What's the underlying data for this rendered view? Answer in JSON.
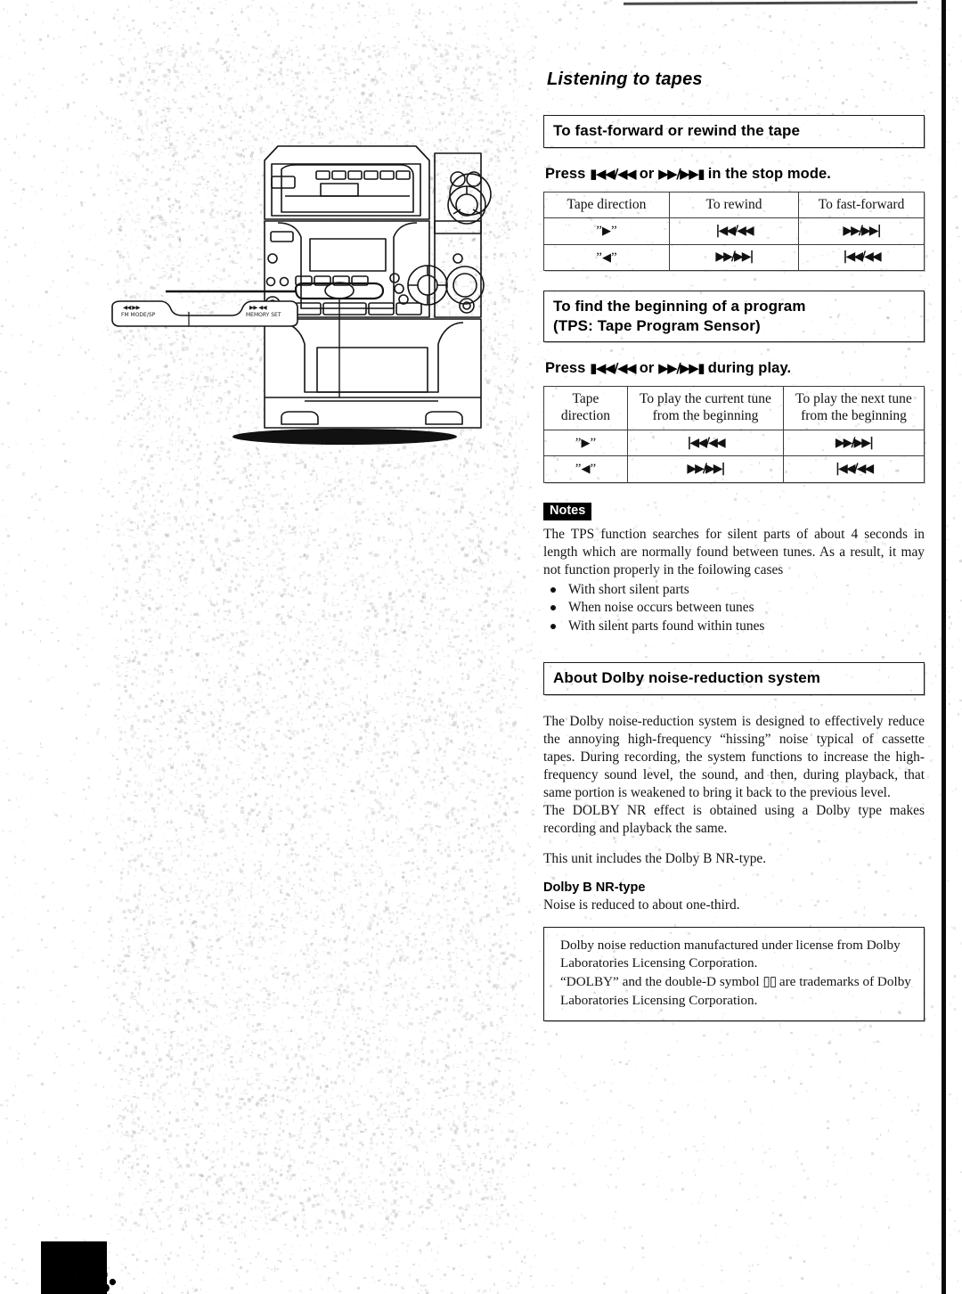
{
  "page": {
    "title": "Listening to tapes"
  },
  "sections": {
    "fast_forward": {
      "heading": "To fast-forward or rewind the tape",
      "press_prefix": "Press",
      "press_glyph_a": "⏪",
      "press_mid": "or",
      "press_glyph_b": "⏩",
      "press_suffix": "in the stop mode.",
      "press_full": "Press |◀◀/◀◀ or ▶▶/▶▶| in the stop mode.",
      "table": {
        "headers": [
          "Tape direction",
          "To rewind",
          "To fast-forward"
        ],
        "rows": [
          {
            "direction": "“▶”",
            "rewind": "|◀◀/◀◀",
            "fast_forward": "▶▶/▶▶|"
          },
          {
            "direction": "“◀”",
            "rewind": "▶▶/▶▶|",
            "fast_forward": "|◀◀/◀◀"
          }
        ]
      }
    },
    "tps": {
      "heading_line1": "To find the beginning of a program",
      "heading_line2": "(TPS: Tape Program Sensor)",
      "press_full": "Press |◀◀/◀◀ or ▶▶/▶▶| during play.",
      "press_prefix": "Press",
      "press_mid": "or",
      "press_suffix": "during play.",
      "table": {
        "headers": [
          "Tape direction",
          "To play the current tune from the beginning",
          "To play the next tune from the beginning"
        ],
        "header_lines": [
          [
            "Tape",
            "direction"
          ],
          [
            "To play the current tune",
            "from the beginning"
          ],
          [
            "To play the next tune",
            "from the beginning"
          ]
        ],
        "rows": [
          {
            "direction": "“▶”",
            "current": "|◀◀/◀◀",
            "next": "▶▶/▶▶|"
          },
          {
            "direction": "“◀”",
            "current": "▶▶/▶▶|",
            "next": "|◀◀/◀◀"
          }
        ]
      }
    },
    "notes": {
      "tag": "Notes",
      "paragraph": "The TPS function searches for silent parts of about 4 seconds in length which are normally found between tunes. As a result, it may not function properly in the foilowing cases",
      "bullets": [
        "With short silent parts",
        "When noise occurs between tunes",
        "With silent parts found within tunes"
      ]
    },
    "dolby": {
      "heading": "About Dolby noise-reduction system",
      "paragraph1": "The Dolby noise-reduction system is designed to effectively reduce the annoying high-frequency “hissing” noise typical of cassette tapes. During recording, the system functions to increase the high-frequency sound level, the sound, and then, during playback, that same portion is weakened to bring it back to the previous level.",
      "paragraph2": "The DOLBY NR effect is obtained using a Dolby type makes recording and playback the same.",
      "paragraph3": "This unit includes the Dolby B NR-type.",
      "sub_heading": "Dolby B NR-type",
      "sub_paragraph": "Noise is reduced to about one-third.",
      "license_line1": "Dolby noise reduction manufactured under license from Dolby Laboratories Licensing Corporation.",
      "license_line2_pre": "“DOLBY” and the double-D symbol",
      "license_symbol": "▯▯",
      "license_line2_post": "are trademarks of Dolby Laboratories Licensing Corporation."
    }
  },
  "illustration": {
    "name": "mini-hifi-system-front-view",
    "callout": {
      "label_left": "FM MODE/SP",
      "label_right": "MEMORY SET"
    }
  },
  "colors": {
    "ink": "#111111",
    "paper": "#ffffff",
    "rule": "#1a1a1a"
  }
}
